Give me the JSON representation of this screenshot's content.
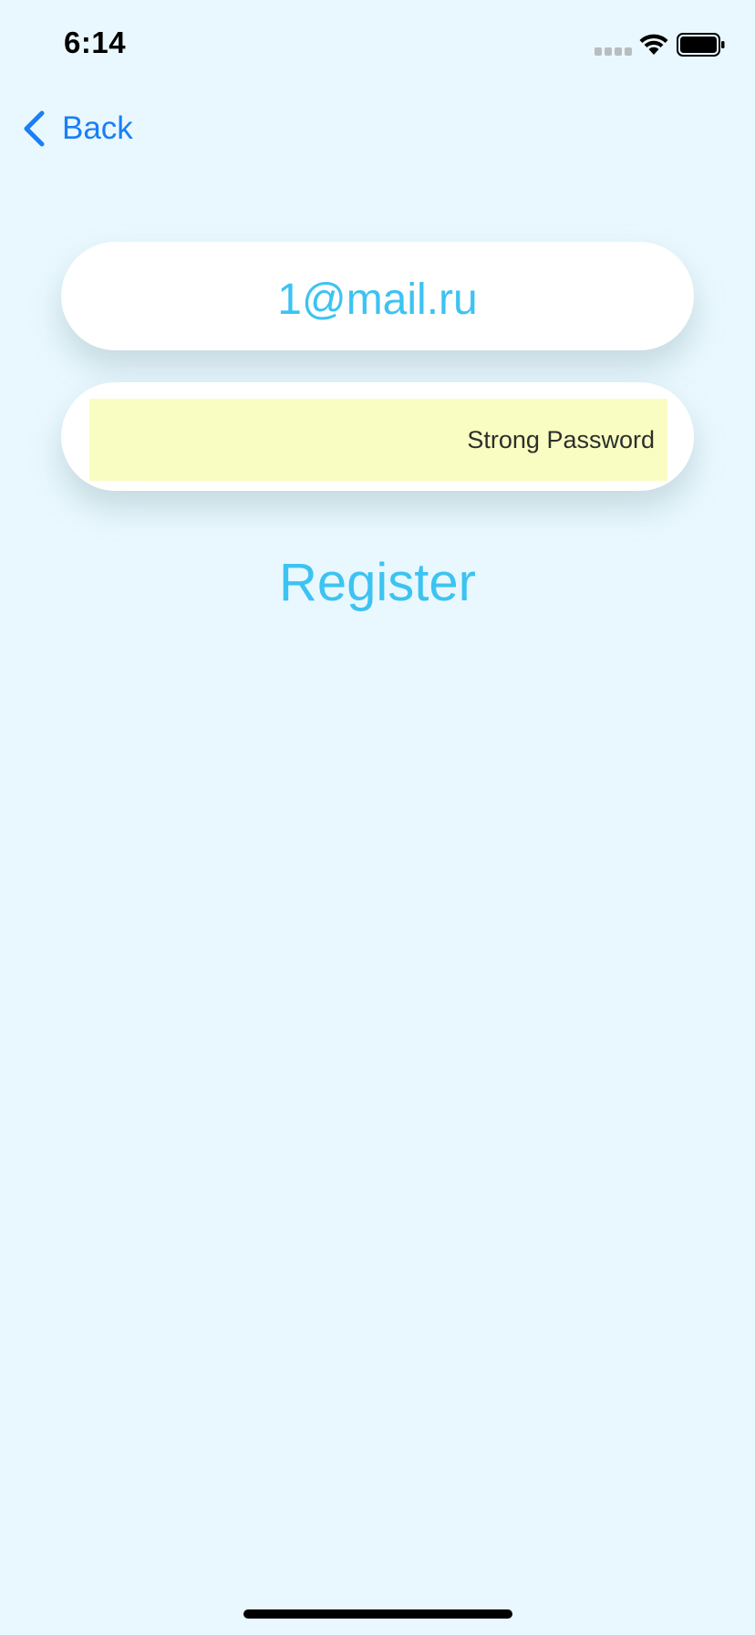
{
  "status_bar": {
    "time": "6:14",
    "icons": [
      "signal-icon",
      "wifi-icon",
      "battery-icon"
    ]
  },
  "nav": {
    "back_label": "Back",
    "back_icon": "chevron-left-icon"
  },
  "form": {
    "email_value": "1@mail.ru",
    "password_suggestion": "Strong Password",
    "register_label": "Register"
  },
  "colors": {
    "background": "#e9f8fe",
    "accent": "#3cc3f2",
    "link": "#1a7ff5",
    "autofill_highlight": "#f9fdc1"
  }
}
